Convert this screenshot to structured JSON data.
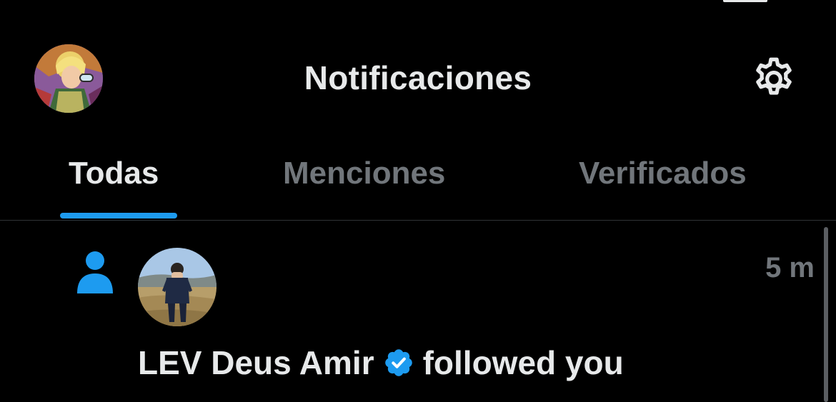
{
  "header": {
    "title": "Notificaciones",
    "avatar_icon": "profile-avatar",
    "settings_icon": "gear-icon"
  },
  "tabs": [
    {
      "label": "Todas",
      "active": true
    },
    {
      "label": "Menciones",
      "active": false
    },
    {
      "label": "Verificados",
      "active": false
    }
  ],
  "notifications": [
    {
      "type_icon": "person-icon",
      "user_name": "LEV Deus Amir",
      "verified": true,
      "action": "followed you",
      "time": "5 m"
    }
  ],
  "colors": {
    "background": "#000000",
    "text_primary": "#e7e9ea",
    "text_secondary": "#71767b",
    "accent": "#1d9bf0",
    "divider": "#2f3336"
  }
}
